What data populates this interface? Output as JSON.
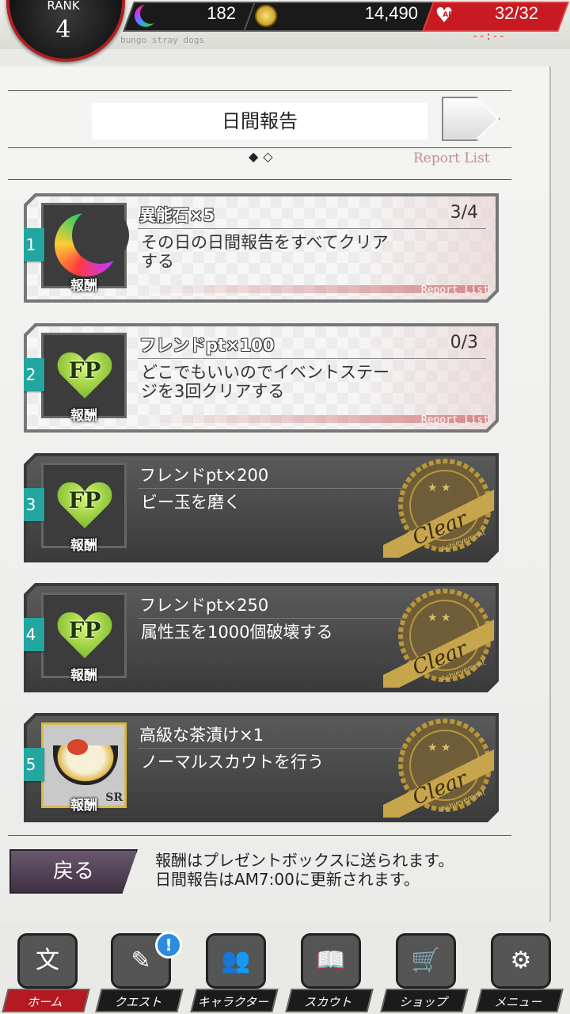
{
  "header": {
    "rank_label": "RANK",
    "rank_value": "4",
    "ability_stones": "182",
    "coins": "14,490",
    "ap": "32/32",
    "ap_icon_text": "AP",
    "ap_timer": "--:--",
    "tagline": "bungo stray dogs"
  },
  "panel": {
    "title": "日間報告",
    "page_dots": "◆◇",
    "report_list_label": "Report List"
  },
  "missions": [
    {
      "number": "1",
      "reward_name": "異能石×5",
      "progress": "3/4",
      "text": "その日の日間報告をすべてクリアする",
      "reward_caption": "報酬",
      "footer": "Report List",
      "status": "open",
      "reward_icon": "ability-stone-icon"
    },
    {
      "number": "2",
      "reward_name": "フレンドpt×100",
      "progress": "0/3",
      "text": "どこでもいいのでイベントステージを3回クリアする",
      "reward_caption": "報酬",
      "footer": "Report List",
      "status": "open",
      "reward_icon": "friend-point-icon",
      "icon_text": "FP"
    },
    {
      "number": "3",
      "reward_name": "フレンドpt×200",
      "text": "ビー玉を磨く",
      "reward_caption": "報酬",
      "status": "clear",
      "reward_icon": "friend-point-icon",
      "icon_text": "FP",
      "stamp_text": "Clear",
      "stamp_sub": "Achievement"
    },
    {
      "number": "4",
      "reward_name": "フレンドpt×250",
      "text": "属性玉を1000個破壊する",
      "reward_caption": "報酬",
      "status": "clear",
      "reward_icon": "friend-point-icon",
      "icon_text": "FP",
      "stamp_text": "Clear",
      "stamp_sub": "Achievement"
    },
    {
      "number": "5",
      "reward_name": "高級な茶漬け×1",
      "text": "ノーマルスカウトを行う",
      "reward_caption": "報酬",
      "status": "clear",
      "reward_icon": "ochazuke-icon",
      "rarity": "SR",
      "stamp_text": "Clear",
      "stamp_sub": "Achievement"
    }
  ],
  "footer": {
    "back_label": "戻る",
    "info_line1": "報酬はプレゼントボックスに送られます。",
    "info_line2": "日間報告はAM7:00に更新されます。"
  },
  "nav": {
    "items": [
      {
        "label": "ホーム",
        "icon": "home-icon",
        "glyph": "文"
      },
      {
        "label": "クエスト",
        "icon": "quest-icon",
        "glyph": "✎",
        "badge": "!"
      },
      {
        "label": "キャラクター",
        "icon": "character-icon",
        "glyph": "👥"
      },
      {
        "label": "スカウト",
        "icon": "scout-icon",
        "glyph": "📖"
      },
      {
        "label": "ショップ",
        "icon": "shop-icon",
        "glyph": "🛒"
      },
      {
        "label": "メニュー",
        "icon": "menu-icon",
        "glyph": "⚙"
      }
    ]
  },
  "colors": {
    "accent_red": "#c81a22",
    "teal_tag": "#23a6a0",
    "stamp_gold": "#b8963a"
  }
}
